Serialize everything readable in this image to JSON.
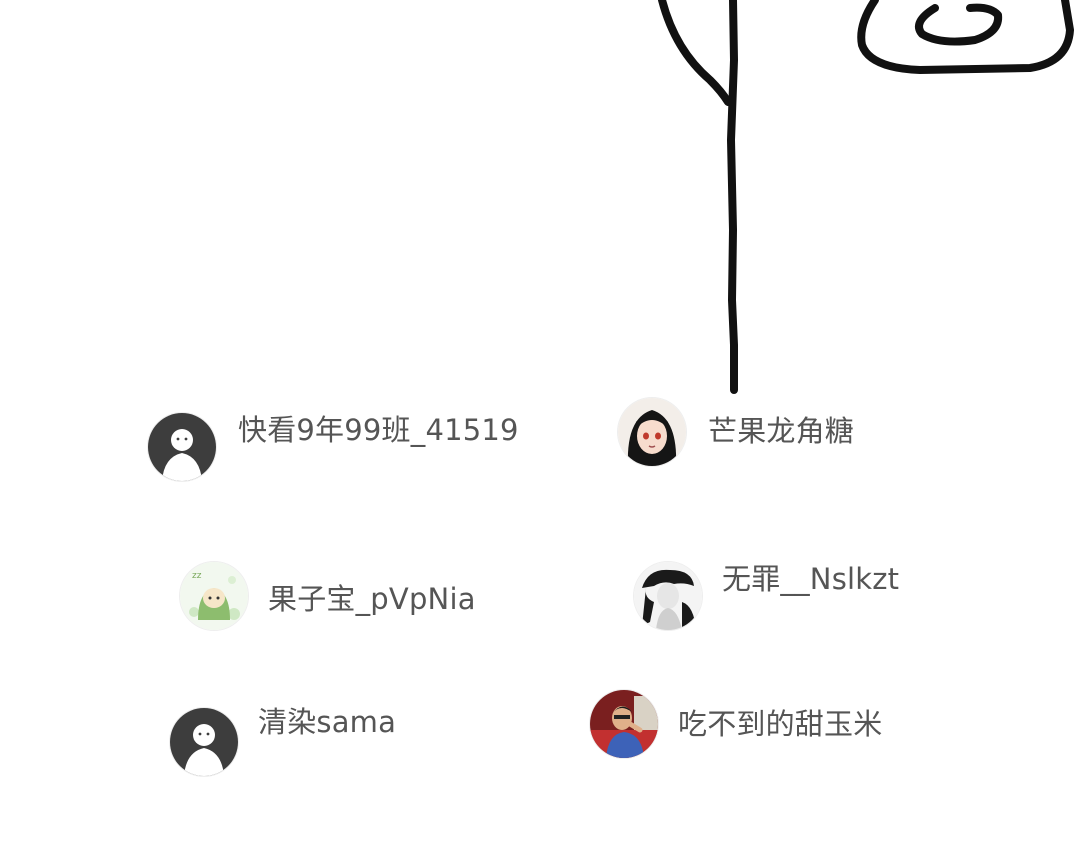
{
  "users": [
    {
      "name": "快看9年99班_41519",
      "avatar": "default-avatar-icon"
    },
    {
      "name": "芒果龙角糖",
      "avatar": "anime-girl-avatar"
    },
    {
      "name": "果子宝_pVpNia",
      "avatar": "green-character-avatar"
    },
    {
      "name": "无罪__Nslkzt",
      "avatar": "monochrome-figure-avatar"
    },
    {
      "name": "清染sama",
      "avatar": "default-avatar-icon"
    },
    {
      "name": "吃不到的甜玉米",
      "avatar": "photo-person-avatar"
    }
  ],
  "colors": {
    "name_text": "#555555",
    "default_avatar_bg": "#3d3d3d",
    "doodle_stroke": "#111111"
  }
}
